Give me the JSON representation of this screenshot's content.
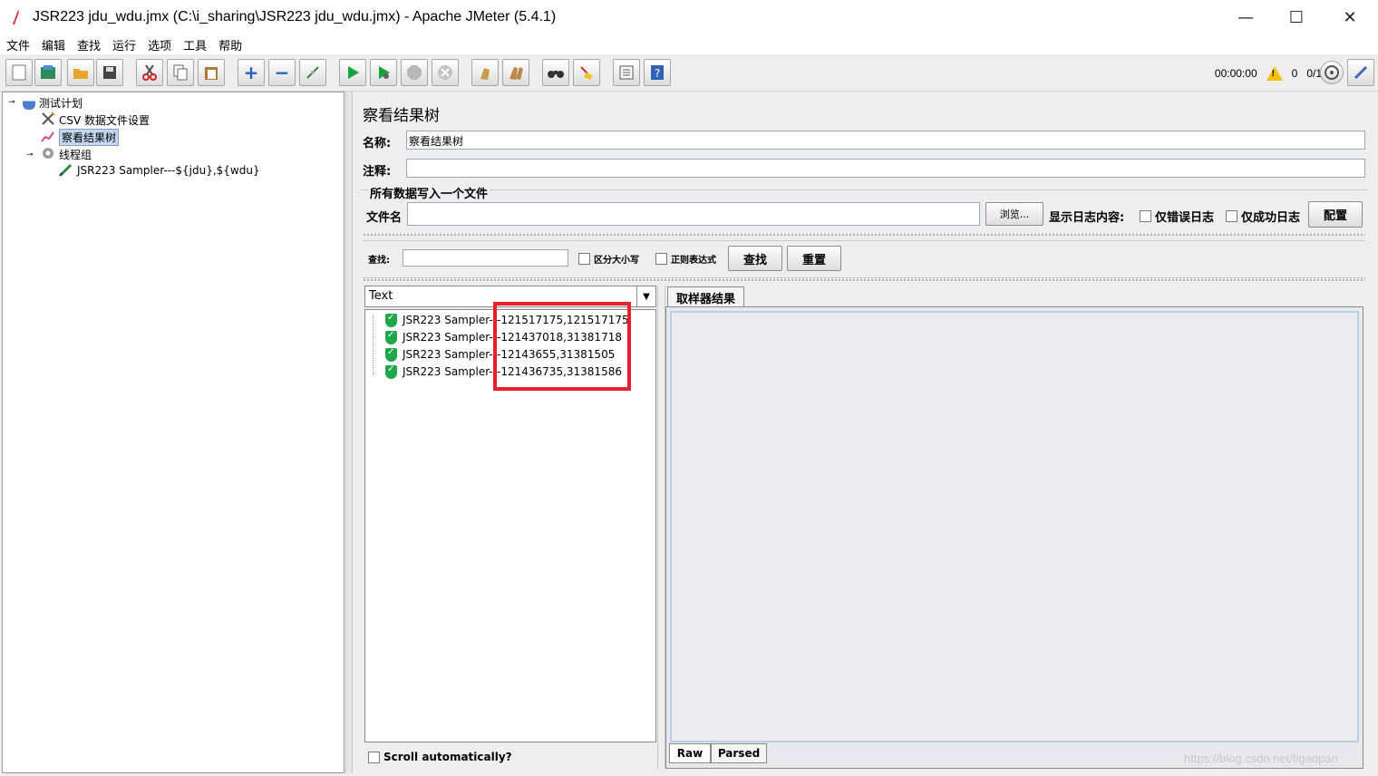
{
  "window": {
    "title": "JSR223 jdu_wdu.jmx (C:\\i_sharing\\JSR223 jdu_wdu.jmx) - Apache JMeter (5.4.1)",
    "minimize": "—",
    "maximize": "☐",
    "close": "✕"
  },
  "menu": [
    "文件",
    "编辑",
    "查找",
    "运行",
    "选项",
    "工具",
    "帮助"
  ],
  "toolbar": {
    "timer": "00:00:00",
    "warning_count": "0",
    "threads": "0/1"
  },
  "tree": {
    "items": [
      {
        "label": "测试计划",
        "icon": "flask-icon"
      },
      {
        "label": "CSV 数据文件设置",
        "icon": "tools-icon"
      },
      {
        "label": "察看结果树",
        "icon": "chart-icon"
      },
      {
        "label": "线程组",
        "icon": "gear-icon"
      },
      {
        "label": "JSR223 Sampler---${jdu},${wdu}",
        "icon": "pen-icon"
      }
    ]
  },
  "panel": {
    "title": "察看结果树",
    "name_label": "名称:",
    "name_value": "察看结果树",
    "comment_label": "注释:",
    "comment_value": "",
    "file_section": "所有数据写入一个文件",
    "filename_label": "文件名",
    "filename_value": "",
    "browse_button": "浏览...",
    "log_label": "显示日志内容:",
    "errors_only": "仅错误日志",
    "success_only": "仅成功日志",
    "configure_button": "配置"
  },
  "search": {
    "label": "查找:",
    "value": "",
    "case_sensitive": "区分大小写",
    "regex": "正则表达式",
    "search_button": "查找",
    "reset_button": "重置"
  },
  "results": {
    "renderer": "Text",
    "items": [
      {
        "label": "JSR223 Sampler---121517175,121517175"
      },
      {
        "label": "JSR223 Sampler---121437018,31381718"
      },
      {
        "label": "JSR223 Sampler---12143655,31381505"
      },
      {
        "label": "JSR223 Sampler---121436735,31381586"
      }
    ],
    "scroll_auto": "Scroll automatically?"
  },
  "detail": {
    "tab": "取样器结果",
    "bottom_tabs": [
      "Raw",
      "Parsed"
    ]
  },
  "watermark": "https://blog.csdn.net/figaopan"
}
